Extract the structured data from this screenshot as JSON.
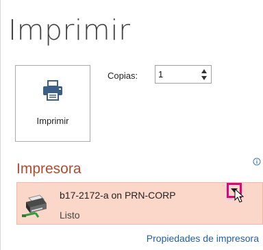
{
  "header": {
    "title": "Imprimir"
  },
  "print_button": {
    "label": "Imprimir",
    "icon": "printer-icon"
  },
  "copies": {
    "label": "Copias:",
    "value": "1"
  },
  "printer_section": {
    "heading": "Impresora",
    "selected_printer": {
      "name": "b17-2172-a on PRN-CORP",
      "status": "Listo",
      "icon": "network-printer-icon"
    },
    "properties_link": "Propiedades de impresora"
  },
  "colors": {
    "heading_accent": "#b54a2f",
    "selected_bg": "#fbd7ca",
    "highlight_border": "#e6007e",
    "link": "#1f5fa8"
  }
}
